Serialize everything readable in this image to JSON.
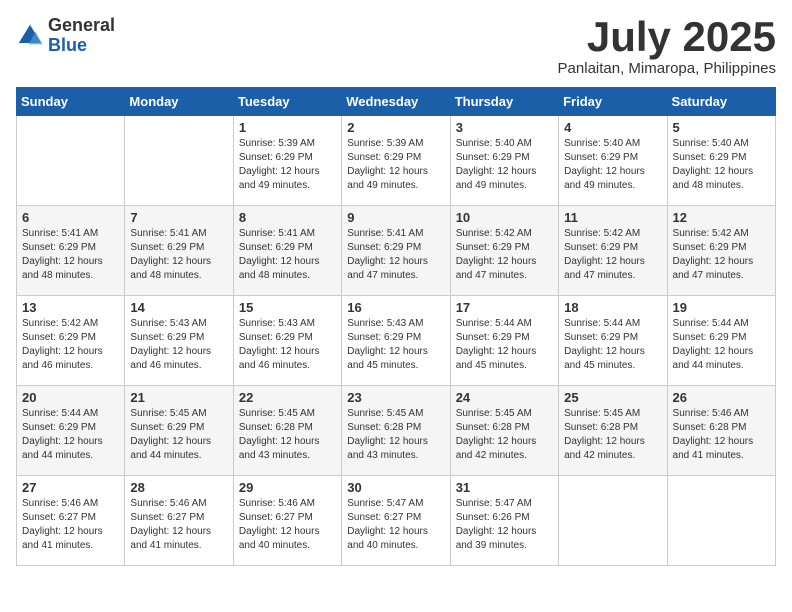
{
  "header": {
    "logo_general": "General",
    "logo_blue": "Blue",
    "month_title": "July 2025",
    "subtitle": "Panlaitan, Mimaropa, Philippines"
  },
  "days_of_week": [
    "Sunday",
    "Monday",
    "Tuesday",
    "Wednesday",
    "Thursday",
    "Friday",
    "Saturday"
  ],
  "weeks": [
    [
      {
        "day": "",
        "info": ""
      },
      {
        "day": "",
        "info": ""
      },
      {
        "day": "1",
        "info": "Sunrise: 5:39 AM\nSunset: 6:29 PM\nDaylight: 12 hours and 49 minutes."
      },
      {
        "day": "2",
        "info": "Sunrise: 5:39 AM\nSunset: 6:29 PM\nDaylight: 12 hours and 49 minutes."
      },
      {
        "day": "3",
        "info": "Sunrise: 5:40 AM\nSunset: 6:29 PM\nDaylight: 12 hours and 49 minutes."
      },
      {
        "day": "4",
        "info": "Sunrise: 5:40 AM\nSunset: 6:29 PM\nDaylight: 12 hours and 49 minutes."
      },
      {
        "day": "5",
        "info": "Sunrise: 5:40 AM\nSunset: 6:29 PM\nDaylight: 12 hours and 48 minutes."
      }
    ],
    [
      {
        "day": "6",
        "info": "Sunrise: 5:41 AM\nSunset: 6:29 PM\nDaylight: 12 hours and 48 minutes."
      },
      {
        "day": "7",
        "info": "Sunrise: 5:41 AM\nSunset: 6:29 PM\nDaylight: 12 hours and 48 minutes."
      },
      {
        "day": "8",
        "info": "Sunrise: 5:41 AM\nSunset: 6:29 PM\nDaylight: 12 hours and 48 minutes."
      },
      {
        "day": "9",
        "info": "Sunrise: 5:41 AM\nSunset: 6:29 PM\nDaylight: 12 hours and 47 minutes."
      },
      {
        "day": "10",
        "info": "Sunrise: 5:42 AM\nSunset: 6:29 PM\nDaylight: 12 hours and 47 minutes."
      },
      {
        "day": "11",
        "info": "Sunrise: 5:42 AM\nSunset: 6:29 PM\nDaylight: 12 hours and 47 minutes."
      },
      {
        "day": "12",
        "info": "Sunrise: 5:42 AM\nSunset: 6:29 PM\nDaylight: 12 hours and 47 minutes."
      }
    ],
    [
      {
        "day": "13",
        "info": "Sunrise: 5:42 AM\nSunset: 6:29 PM\nDaylight: 12 hours and 46 minutes."
      },
      {
        "day": "14",
        "info": "Sunrise: 5:43 AM\nSunset: 6:29 PM\nDaylight: 12 hours and 46 minutes."
      },
      {
        "day": "15",
        "info": "Sunrise: 5:43 AM\nSunset: 6:29 PM\nDaylight: 12 hours and 46 minutes."
      },
      {
        "day": "16",
        "info": "Sunrise: 5:43 AM\nSunset: 6:29 PM\nDaylight: 12 hours and 45 minutes."
      },
      {
        "day": "17",
        "info": "Sunrise: 5:44 AM\nSunset: 6:29 PM\nDaylight: 12 hours and 45 minutes."
      },
      {
        "day": "18",
        "info": "Sunrise: 5:44 AM\nSunset: 6:29 PM\nDaylight: 12 hours and 45 minutes."
      },
      {
        "day": "19",
        "info": "Sunrise: 5:44 AM\nSunset: 6:29 PM\nDaylight: 12 hours and 44 minutes."
      }
    ],
    [
      {
        "day": "20",
        "info": "Sunrise: 5:44 AM\nSunset: 6:29 PM\nDaylight: 12 hours and 44 minutes."
      },
      {
        "day": "21",
        "info": "Sunrise: 5:45 AM\nSunset: 6:29 PM\nDaylight: 12 hours and 44 minutes."
      },
      {
        "day": "22",
        "info": "Sunrise: 5:45 AM\nSunset: 6:28 PM\nDaylight: 12 hours and 43 minutes."
      },
      {
        "day": "23",
        "info": "Sunrise: 5:45 AM\nSunset: 6:28 PM\nDaylight: 12 hours and 43 minutes."
      },
      {
        "day": "24",
        "info": "Sunrise: 5:45 AM\nSunset: 6:28 PM\nDaylight: 12 hours and 42 minutes."
      },
      {
        "day": "25",
        "info": "Sunrise: 5:45 AM\nSunset: 6:28 PM\nDaylight: 12 hours and 42 minutes."
      },
      {
        "day": "26",
        "info": "Sunrise: 5:46 AM\nSunset: 6:28 PM\nDaylight: 12 hours and 41 minutes."
      }
    ],
    [
      {
        "day": "27",
        "info": "Sunrise: 5:46 AM\nSunset: 6:27 PM\nDaylight: 12 hours and 41 minutes."
      },
      {
        "day": "28",
        "info": "Sunrise: 5:46 AM\nSunset: 6:27 PM\nDaylight: 12 hours and 41 minutes."
      },
      {
        "day": "29",
        "info": "Sunrise: 5:46 AM\nSunset: 6:27 PM\nDaylight: 12 hours and 40 minutes."
      },
      {
        "day": "30",
        "info": "Sunrise: 5:47 AM\nSunset: 6:27 PM\nDaylight: 12 hours and 40 minutes."
      },
      {
        "day": "31",
        "info": "Sunrise: 5:47 AM\nSunset: 6:26 PM\nDaylight: 12 hours and 39 minutes."
      },
      {
        "day": "",
        "info": ""
      },
      {
        "day": "",
        "info": ""
      }
    ]
  ]
}
